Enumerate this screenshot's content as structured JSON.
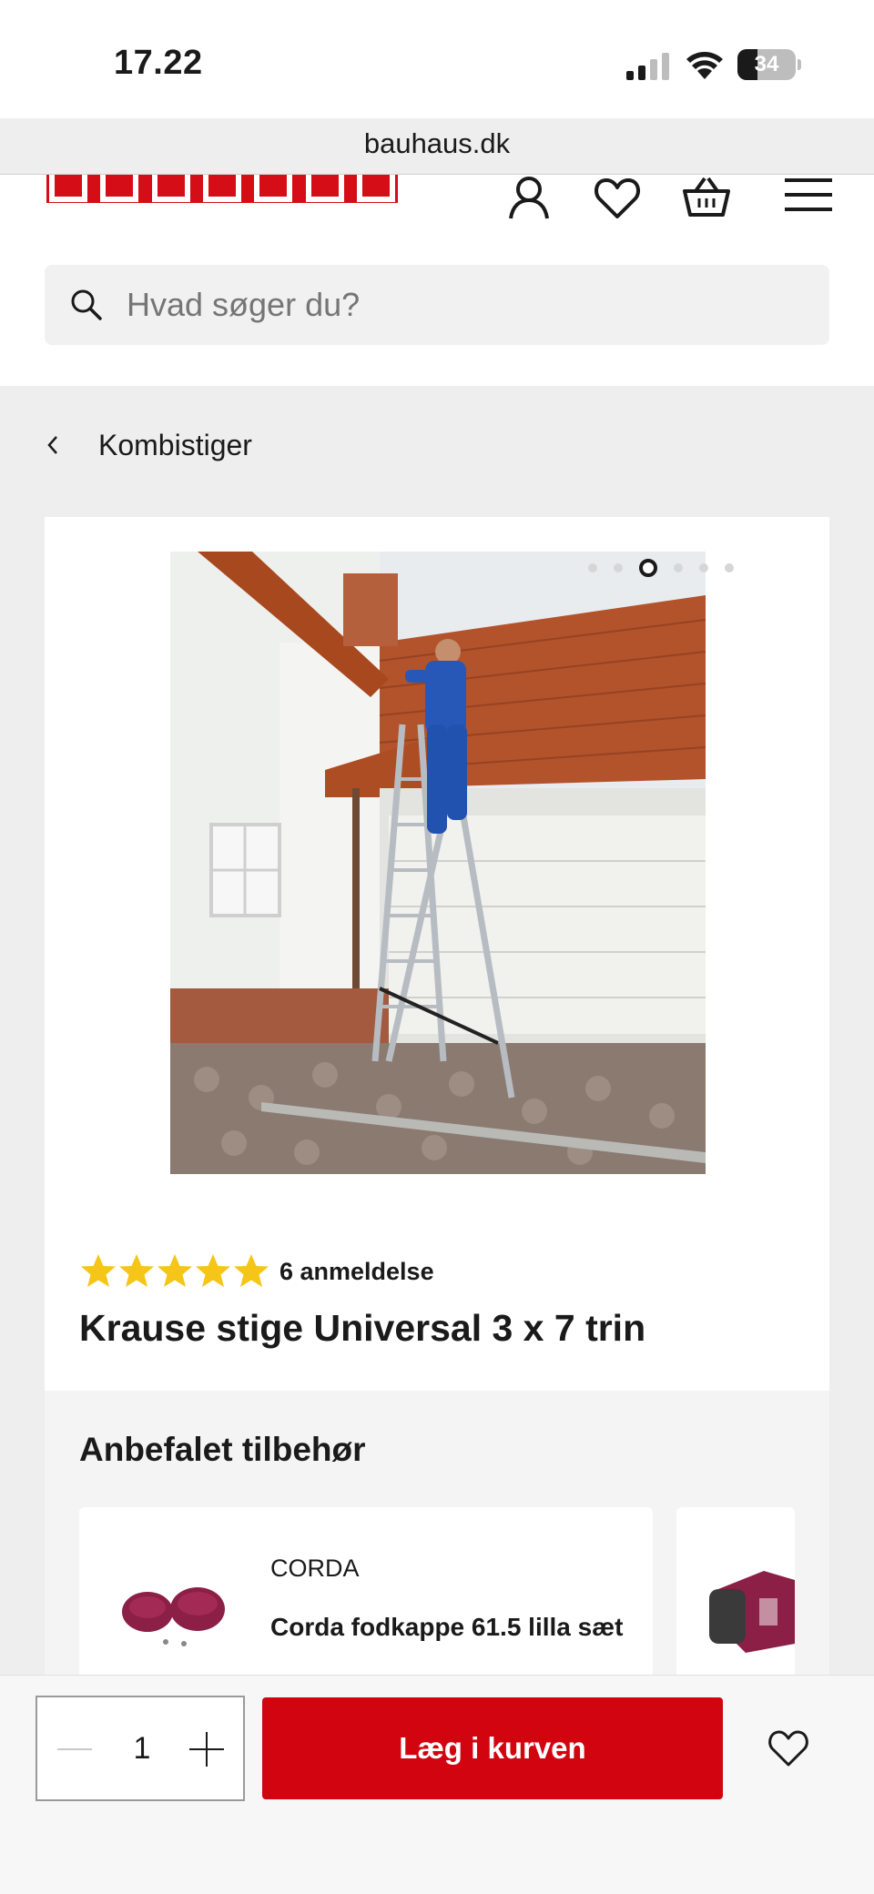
{
  "status_bar": {
    "time": "17.22",
    "battery_level": "34",
    "battery_percent": 34
  },
  "browser": {
    "url": "bauhaus.dk"
  },
  "header": {
    "logo_text": "BAUHAUS",
    "brand_color": "#d50d17",
    "icons": [
      "account-icon",
      "heart-icon",
      "basket-icon",
      "menu-icon"
    ]
  },
  "search": {
    "placeholder": "Hvad søger du?"
  },
  "breadcrumb": {
    "label": "Kombistiger"
  },
  "product": {
    "image_count": 6,
    "active_image": 3,
    "rating_stars": 5,
    "review_count_label": "6 anmeldelse",
    "title": "Krause stige Universal 3 x 7 trin"
  },
  "accessories": {
    "title": "Anbefalet tilbehør",
    "items": [
      {
        "brand": "CORDA",
        "name": "Corda fodkappe 61.5 lilla sæt"
      },
      {
        "brand": "",
        "name": ""
      }
    ]
  },
  "cart_bar": {
    "quantity": "1",
    "add_label": "Læg i kurven",
    "button_color": "#d2040f"
  }
}
